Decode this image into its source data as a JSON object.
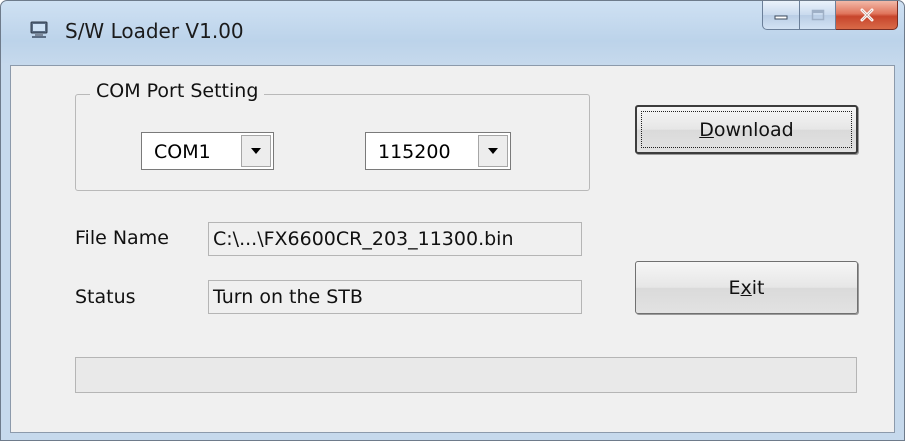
{
  "window": {
    "title": "S/W Loader V1.00",
    "icon": "app-computer-icon"
  },
  "caption_buttons": {
    "minimize_icon": "minimize-icon",
    "maximize_icon": "maximize-icon",
    "close_icon": "close-icon",
    "close_color": "#c7452c"
  },
  "com_port_setting": {
    "group_label": "COM Port Setting",
    "port": {
      "value": "COM1"
    },
    "baud_rate": {
      "value": "115200"
    }
  },
  "buttons": {
    "download_label": "Download",
    "download_mnemonic": "D",
    "download_rest": "ownload",
    "exit_label": "Exit",
    "exit_pre": "E",
    "exit_mnemonic": "x",
    "exit_post": "it"
  },
  "file_name": {
    "label": "File Name",
    "value": "C:\\...\\FX6600CR_203_11300.bin"
  },
  "status": {
    "label": "Status",
    "value": "Turn on the STB"
  },
  "progress": {
    "percent": 0
  }
}
